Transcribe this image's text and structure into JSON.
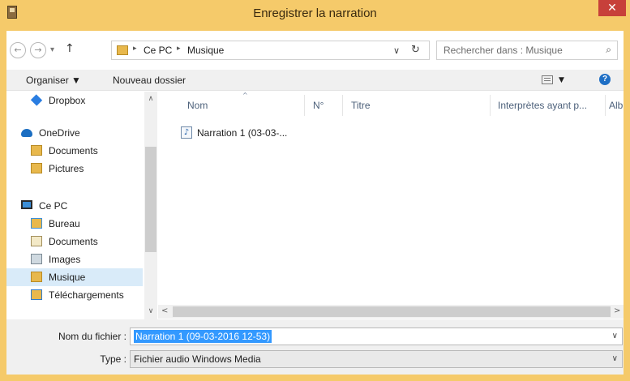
{
  "window": {
    "title": "Enregistrer la narration",
    "close_glyph": "✕"
  },
  "address": {
    "back_glyph": "←",
    "forward_glyph": "→",
    "recent_glyph": "▾",
    "up_glyph": "↑",
    "breadcrumbs": [
      "Ce PC",
      "Musique"
    ],
    "separator_glyph": "▸",
    "dropdown_glyph": "∨",
    "refresh_glyph": "↻"
  },
  "search": {
    "placeholder": "Rechercher dans : Musique",
    "icon": "search-icon"
  },
  "toolbar": {
    "organize_label": "Organiser ▼",
    "new_folder_label": "Nouveau dossier",
    "view_dropdown": "▼",
    "help_glyph": "?"
  },
  "nav": {
    "items": [
      {
        "label": "Dropbox",
        "icon": "dropbox-icon"
      },
      {
        "label": "OneDrive",
        "icon": "onedrive-icon"
      },
      {
        "label": "Documents",
        "icon": "folder-icon"
      },
      {
        "label": "Pictures",
        "icon": "folder-icon"
      },
      {
        "label": "Ce PC",
        "icon": "computer-icon"
      },
      {
        "label": "Bureau",
        "icon": "desktop-folder-icon"
      },
      {
        "label": "Documents",
        "icon": "documents-folder-icon"
      },
      {
        "label": "Images",
        "icon": "images-folder-icon"
      },
      {
        "label": "Musique",
        "icon": "music-folder-icon",
        "selected": true
      },
      {
        "label": "Téléchargements",
        "icon": "downloads-folder-icon"
      }
    ],
    "scroll_up": "∧",
    "scroll_down": "∨"
  },
  "list": {
    "columns": [
      "Nom",
      "N°",
      "Titre",
      "Interprètes ayant p...",
      "Albu"
    ],
    "sort_glyph": "^",
    "files": [
      {
        "name": "Narration 1 (03-03-...",
        "icon": "audio-file-icon",
        "glyph": "♪"
      }
    ],
    "scroll_left": "<",
    "scroll_right": ">"
  },
  "footer": {
    "filename_label": "Nom du fichier :",
    "filename_value": "Narration 1 (09-03-2016 12-53)",
    "type_label": "Type :",
    "type_value": "Fichier audio Windows Media",
    "dropdown_glyph": "∨"
  },
  "colors": {
    "title_bar": "#f5ca6a",
    "close_button": "#c7403a",
    "selection": "#3399ff",
    "nav_selected": "#d9ebf9"
  }
}
